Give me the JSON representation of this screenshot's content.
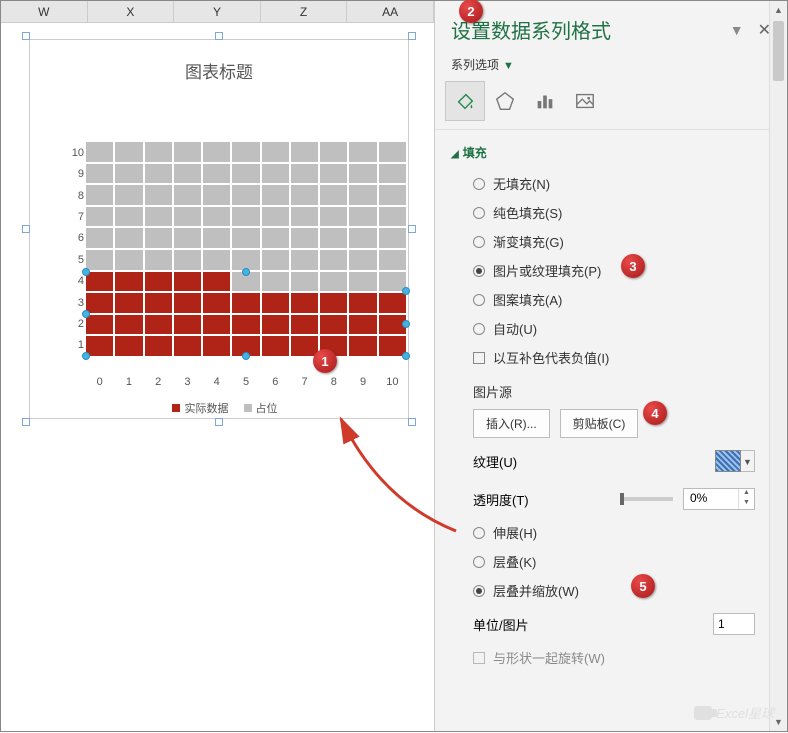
{
  "columns": [
    "W",
    "X",
    "Y",
    "Z",
    "AA"
  ],
  "panel": {
    "title": "设置数据系列格式",
    "subtitle": "系列选项",
    "section_fill": "填充",
    "radios": {
      "none": "无填充(N)",
      "solid": "纯色填充(S)",
      "gradient": "渐变填充(G)",
      "picture": "图片或纹理填充(P)",
      "pattern": "图案填充(A)",
      "auto": "自动(U)"
    },
    "invert_check": "以互补色代表负值(I)",
    "picture_source_label": "图片源",
    "insert_btn": "插入(R)...",
    "clipboard_btn": "剪贴板(C)",
    "texture_label": "纹理(U)",
    "transparency_label": "透明度(T)",
    "transparency_value": "0%",
    "stretch": "伸展(H)",
    "stack": "层叠(K)",
    "stack_scale": "层叠并缩放(W)",
    "units_label": "单位/图片",
    "units_value": "1",
    "rotate_check": "与形状一起旋转(W)"
  },
  "watermark": "Excel星球",
  "chart_data": {
    "type": "bar",
    "title": "图表标题",
    "categories": [
      0,
      1,
      2,
      3,
      4,
      5,
      6,
      7,
      8,
      9,
      10
    ],
    "series": [
      {
        "name": "实际数据",
        "values": [
          4,
          4,
          4,
          4,
          4,
          3,
          3,
          3,
          3,
          3,
          3
        ],
        "color": "#b02418"
      },
      {
        "name": "占位",
        "values": [
          6,
          6,
          6,
          6,
          6,
          7,
          7,
          7,
          7,
          7,
          7
        ],
        "color": "#bfbfbf"
      }
    ],
    "xlabel": "",
    "ylabel": "",
    "ylim": [
      0,
      10
    ],
    "xlim": [
      0,
      10
    ],
    "y_ticks": [
      1,
      2,
      3,
      4,
      5,
      6,
      7,
      8,
      9,
      10
    ],
    "x_ticks": [
      0,
      1,
      2,
      3,
      4,
      5,
      6,
      7,
      8,
      9,
      10
    ]
  },
  "callouts": [
    "1",
    "2",
    "3",
    "4",
    "5"
  ]
}
